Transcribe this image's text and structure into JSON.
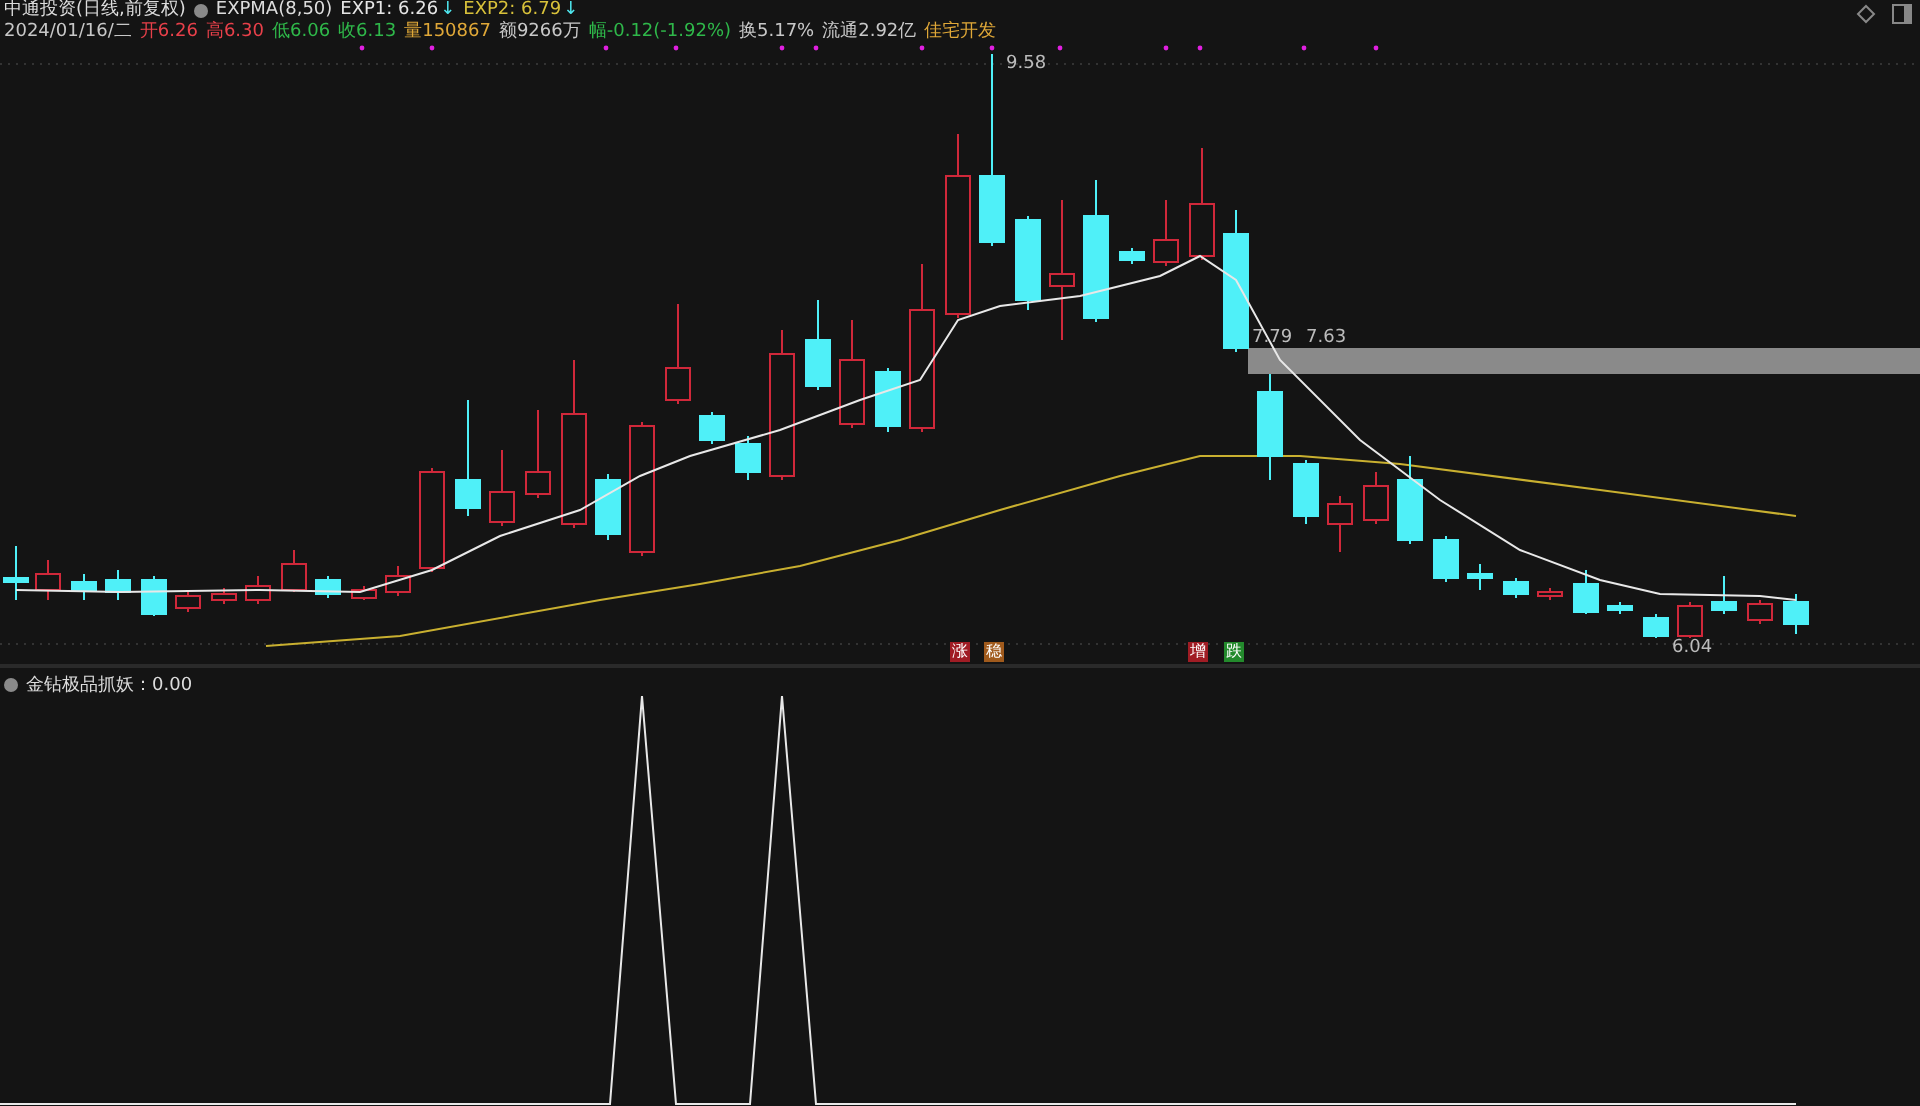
{
  "title": "中通投资(日线,前复权)",
  "indicator": {
    "name": "EXPMA(8,50)",
    "values": [
      {
        "text": "EXP1: 6.26",
        "color": "#e6e6e6",
        "mark": "↓"
      },
      {
        "text": "EXP2: 6.79",
        "color": "#d8c13a",
        "mark": "↓"
      }
    ]
  },
  "quote": [
    {
      "text": "2024/01/16/二",
      "color": "#c8c8c8"
    },
    {
      "text": "开6.26",
      "color": "#e8404a"
    },
    {
      "text": "高6.30",
      "color": "#e8404a"
    },
    {
      "text": "低6.06",
      "color": "#2fb84a"
    },
    {
      "text": "收6.13",
      "color": "#2fb84a"
    },
    {
      "text": "量150867",
      "color": "#e0a838"
    },
    {
      "text": "额9266万",
      "color": "#c8c8c8"
    },
    {
      "text": "幅-0.12(-1.92%)",
      "color": "#2fb84a"
    },
    {
      "text": "换5.17%",
      "color": "#c8c8c8"
    },
    {
      "text": "流通2.92亿",
      "color": "#c8c8c8"
    },
    {
      "text": "佳宅开发",
      "color": "#e0a838"
    }
  ],
  "price_labels": [
    {
      "kind": "high",
      "text": "9.58"
    },
    {
      "kind": "low",
      "text": "6.04"
    },
    {
      "kind": "level",
      "text": "7.79"
    },
    {
      "kind": "level2",
      "text": "7.63"
    }
  ],
  "badges": [
    {
      "text": "涨",
      "color": "#a01c24"
    },
    {
      "text": "稳",
      "color": "#a05a1c"
    },
    {
      "text": "增",
      "color": "#a01c24"
    },
    {
      "text": "跌",
      "color": "#238a2c"
    }
  ],
  "sub_panel": {
    "title": "金钻极品抓妖：0.00"
  }
}
